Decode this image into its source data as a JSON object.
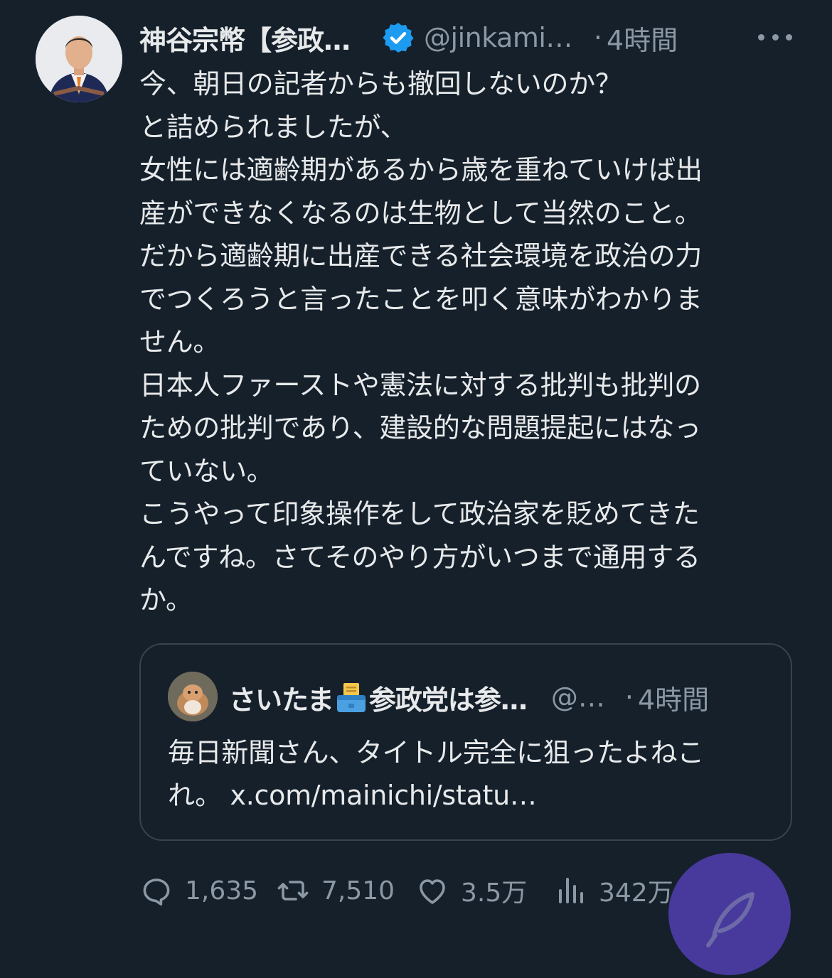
{
  "tweet": {
    "author_name": "神谷宗幣【参政…",
    "handle": "@jinkami…",
    "dot": "·",
    "time": "4時間",
    "lines": [
      "今、朝日の記者からも撤回しないのか？",
      "と詰められましたが、",
      "女性には適齢期があるから歳を重ねていけば出",
      "産ができなくなるのは生物として当然のこと。",
      "だから適齢期に出産できる社会環境を政治の力",
      "でつくろうと言ったことを叩く意味がわかりま",
      "せん。",
      "日本人ファーストや憲法に対する批判も批判の",
      "ための批判であり、建設的な問題提起にはなっ",
      "ていない。",
      "こうやって印象操作をして政治家を貶めてきた",
      "んですね。さてそのやり方がいつまで通用する",
      "か。"
    ]
  },
  "quote": {
    "author_name_a": "さいたま",
    "author_name_b": "参政党は参…",
    "handle": "@…",
    "dot": "·",
    "time": "4時間",
    "lines": [
      "毎日新聞さん、タイトル完全に狙ったよねこ",
      "れ。 x.com/mainichi/statu…"
    ]
  },
  "actions": {
    "replies": "1,635",
    "reposts": "7,510",
    "likes": "3.5万",
    "views": "342万"
  },
  "icons": {
    "verified": "verified-badge-icon",
    "more": "more-icon",
    "reply": "reply-icon",
    "repost": "repost-icon",
    "like": "heart-icon",
    "views": "views-icon",
    "bookmark": "bookmark-icon",
    "share": "share-icon",
    "compose": "feather-icon",
    "emoji": "ballot-box-icon"
  },
  "colors": {
    "background": "#15202b",
    "text": "#e7e9ea",
    "muted": "#8b98a5",
    "verified": "#1d9bf0",
    "fab": "#473a9c"
  }
}
